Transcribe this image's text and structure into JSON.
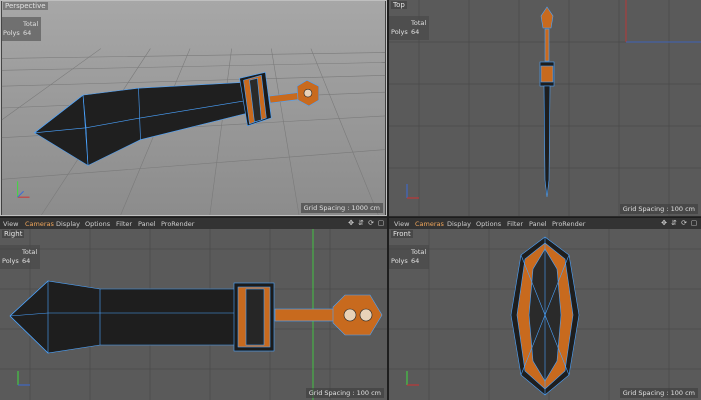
{
  "viewports": {
    "perspective": {
      "label": "Perspective",
      "stats": {
        "header": "Total",
        "polys_label": "Polys",
        "polys_value": "64"
      },
      "grid_spacing": "Grid Spacing : 1000 cm"
    },
    "top": {
      "label": "Top",
      "stats": {
        "header": "Total",
        "polys_label": "Polys",
        "polys_value": "64"
      },
      "grid_spacing": "Grid Spacing : 100 cm"
    },
    "right": {
      "label": "Right",
      "stats": {
        "header": "Total",
        "polys_label": "Polys",
        "polys_value": "64"
      },
      "grid_spacing": "Grid Spacing : 100 cm"
    },
    "front": {
      "label": "Front",
      "stats": {
        "header": "Total",
        "polys_label": "Polys",
        "polys_value": "64"
      },
      "grid_spacing": "Grid Spacing : 100 cm"
    }
  },
  "menubar": {
    "view": "View",
    "cameras": "Cameras",
    "display": "Display",
    "options": "Options",
    "filter": "Filter",
    "panel": "Panel",
    "prorender": "ProRender"
  },
  "nav_icons": [
    "move-view-icon",
    "scale-view-icon",
    "rotate-view-icon",
    "maximize-view-icon"
  ],
  "colors": {
    "accent": "#f0a65b",
    "selection": "#4aa3ff",
    "mesh_dark": "#1e1e1e",
    "mesh_orange": "#c86a1e",
    "y_axis": "#3ddc3d",
    "x_axis": "#d03030"
  }
}
